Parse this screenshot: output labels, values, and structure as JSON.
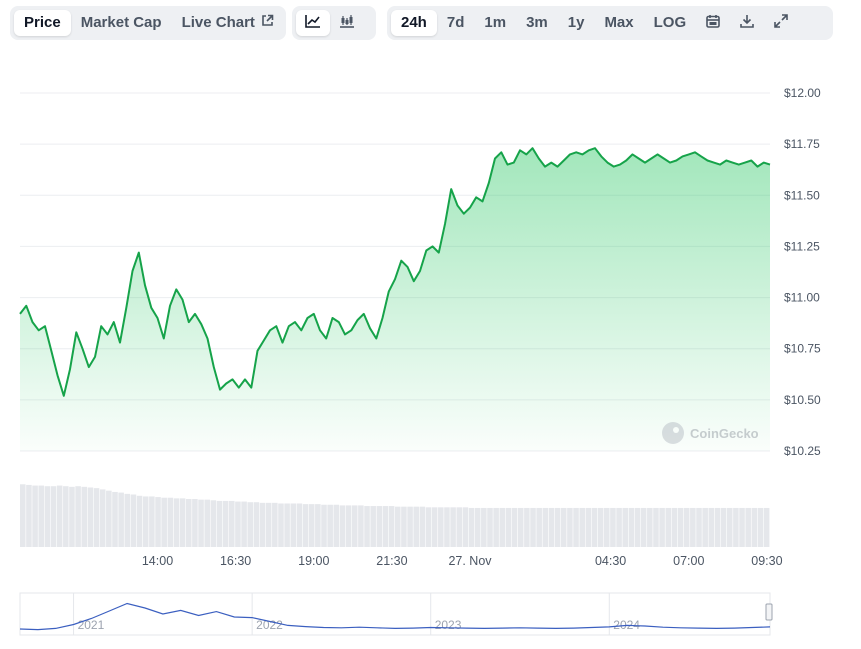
{
  "toolbar": {
    "tabs": [
      "Price",
      "Market Cap",
      "Live Chart"
    ],
    "timeframes": [
      "24h",
      "7d",
      "1m",
      "3m",
      "1y",
      "Max",
      "LOG"
    ],
    "icons": [
      "line-chart-icon",
      "candlestick-icon",
      "calendar-icon",
      "download-icon",
      "expand-icon",
      "external-link-icon"
    ]
  },
  "watermark": "CoinGecko",
  "colors": {
    "line": "#16a34a",
    "area": "#22c55e",
    "volume": "#e5e7eb",
    "navigator": "#3b5fc0"
  },
  "chart_data": {
    "type": "area",
    "currency": "$",
    "ylim": [
      10.25,
      12.0
    ],
    "y_ticks": [
      "$12.00",
      "$11.75",
      "$11.50",
      "$11.25",
      "$11.00",
      "$10.75",
      "$10.50",
      "$10.25"
    ],
    "y_tick_values": [
      12.0,
      11.75,
      11.5,
      11.25,
      11.0,
      10.75,
      10.5,
      10.25
    ],
    "x_ticks": [
      "14:00",
      "16:30",
      "19:00",
      "21:30",
      "27. Nov",
      "04:30",
      "07:00",
      "09:30"
    ],
    "x_tick_hours": [
      14.0,
      16.5,
      19.0,
      21.5,
      24.0,
      28.5,
      31.0,
      33.5
    ],
    "xlim_hours": [
      9.6,
      33.6
    ],
    "price": {
      "hours": [
        9.6,
        9.8,
        10.0,
        10.2,
        10.4,
        10.6,
        10.8,
        11.0,
        11.2,
        11.4,
        11.6,
        11.8,
        12.0,
        12.2,
        12.4,
        12.6,
        12.8,
        13.0,
        13.2,
        13.4,
        13.6,
        13.8,
        14.0,
        14.2,
        14.4,
        14.6,
        14.8,
        15.0,
        15.2,
        15.4,
        15.6,
        15.8,
        16.0,
        16.2,
        16.4,
        16.6,
        16.8,
        17.0,
        17.2,
        17.4,
        17.6,
        17.8,
        18.0,
        18.2,
        18.4,
        18.6,
        18.8,
        19.0,
        19.2,
        19.4,
        19.6,
        19.8,
        20.0,
        20.2,
        20.4,
        20.6,
        20.8,
        21.0,
        21.2,
        21.4,
        21.6,
        21.8,
        22.0,
        22.2,
        22.4,
        22.6,
        22.8,
        23.0,
        23.2,
        23.4,
        23.6,
        23.8,
        24.0,
        24.2,
        24.4,
        24.6,
        24.8,
        25.0,
        25.2,
        25.4,
        25.6,
        25.8,
        26.0,
        26.2,
        26.4,
        26.6,
        26.8,
        27.0,
        27.2,
        27.4,
        27.6,
        27.8,
        28.0,
        28.2,
        28.4,
        28.6,
        28.8,
        29.0,
        29.2,
        29.4,
        29.6,
        29.8,
        30.0,
        30.2,
        30.4,
        30.6,
        30.8,
        31.0,
        31.2,
        31.4,
        31.6,
        31.8,
        32.0,
        32.2,
        32.4,
        32.6,
        32.8,
        33.0,
        33.2,
        33.4,
        33.6
      ],
      "values": [
        10.92,
        10.96,
        10.88,
        10.84,
        10.86,
        10.74,
        10.62,
        10.52,
        10.65,
        10.83,
        10.75,
        10.66,
        10.71,
        10.86,
        10.82,
        10.88,
        10.78,
        10.95,
        11.13,
        11.22,
        11.06,
        10.95,
        10.9,
        10.8,
        10.96,
        11.04,
        10.99,
        10.88,
        10.92,
        10.87,
        10.8,
        10.66,
        10.55,
        10.58,
        10.6,
        10.56,
        10.6,
        10.56,
        10.74,
        10.79,
        10.84,
        10.86,
        10.78,
        10.86,
        10.88,
        10.84,
        10.9,
        10.92,
        10.84,
        10.8,
        10.9,
        10.88,
        10.82,
        10.84,
        10.89,
        10.92,
        10.85,
        10.8,
        10.9,
        11.03,
        11.09,
        11.18,
        11.15,
        11.08,
        11.13,
        11.23,
        11.25,
        11.22,
        11.36,
        11.53,
        11.45,
        11.41,
        11.44,
        11.49,
        11.47,
        11.56,
        11.68,
        11.71,
        11.65,
        11.66,
        11.72,
        11.7,
        11.73,
        11.68,
        11.64,
        11.66,
        11.64,
        11.67,
        11.7,
        11.71,
        11.7,
        11.72,
        11.73,
        11.69,
        11.66,
        11.64,
        11.65,
        11.67,
        11.7,
        11.68,
        11.66,
        11.68,
        11.7,
        11.68,
        11.66,
        11.67,
        11.69,
        11.7,
        11.71,
        11.69,
        11.67,
        11.66,
        11.65,
        11.67,
        11.66,
        11.65,
        11.66,
        11.67,
        11.64,
        11.66,
        11.65
      ]
    },
    "volume_relative": [
      0.98,
      0.97,
      0.96,
      0.96,
      0.95,
      0.95,
      0.96,
      0.95,
      0.94,
      0.95,
      0.94,
      0.93,
      0.92,
      0.9,
      0.88,
      0.86,
      0.85,
      0.83,
      0.82,
      0.8,
      0.79,
      0.79,
      0.78,
      0.77,
      0.77,
      0.76,
      0.76,
      0.75,
      0.75,
      0.74,
      0.74,
      0.73,
      0.72,
      0.72,
      0.72,
      0.71,
      0.71,
      0.7,
      0.7,
      0.69,
      0.69,
      0.69,
      0.68,
      0.68,
      0.68,
      0.68,
      0.67,
      0.67,
      0.67,
      0.66,
      0.66,
      0.66,
      0.65,
      0.65,
      0.65,
      0.65,
      0.64,
      0.64,
      0.64,
      0.64,
      0.64,
      0.63,
      0.63,
      0.63,
      0.63,
      0.63,
      0.62,
      0.62,
      0.62,
      0.62,
      0.62,
      0.62,
      0.62,
      0.61,
      0.61,
      0.61,
      0.61,
      0.61,
      0.61,
      0.61,
      0.61,
      0.61,
      0.61,
      0.61,
      0.61,
      0.61,
      0.61,
      0.61,
      0.61,
      0.61,
      0.61,
      0.61,
      0.61,
      0.61,
      0.61,
      0.61,
      0.61,
      0.61,
      0.61,
      0.61,
      0.61,
      0.61,
      0.61,
      0.61,
      0.61,
      0.61,
      0.61,
      0.61,
      0.61,
      0.61,
      0.61,
      0.61,
      0.61,
      0.61,
      0.61,
      0.61,
      0.61,
      0.61,
      0.61,
      0.61,
      0.61,
      0.61
    ],
    "navigator": {
      "x_labels": [
        "2021",
        "2022",
        "2023",
        "2024"
      ],
      "label_years": [
        2021,
        2022,
        2023,
        2024
      ],
      "range_years": [
        2020.7,
        2024.9
      ],
      "years": [
        2020.7,
        2020.8,
        2020.9,
        2021.0,
        2021.1,
        2021.2,
        2021.3,
        2021.4,
        2021.5,
        2021.6,
        2021.7,
        2021.8,
        2021.9,
        2022.0,
        2022.1,
        2022.2,
        2022.3,
        2022.4,
        2022.5,
        2022.6,
        2022.7,
        2022.8,
        2022.9,
        2023.0,
        2023.1,
        2023.2,
        2023.3,
        2023.4,
        2023.5,
        2023.6,
        2023.7,
        2023.8,
        2023.9,
        2024.0,
        2024.1,
        2024.2,
        2024.3,
        2024.4,
        2024.5,
        2024.6,
        2024.7,
        2024.8,
        2024.9
      ],
      "relative": [
        0.1,
        0.08,
        0.12,
        0.25,
        0.45,
        0.7,
        0.95,
        0.8,
        0.6,
        0.72,
        0.55,
        0.68,
        0.5,
        0.48,
        0.35,
        0.22,
        0.18,
        0.15,
        0.14,
        0.16,
        0.14,
        0.12,
        0.13,
        0.15,
        0.14,
        0.13,
        0.12,
        0.13,
        0.14,
        0.13,
        0.12,
        0.13,
        0.15,
        0.17,
        0.22,
        0.2,
        0.16,
        0.14,
        0.13,
        0.12,
        0.13,
        0.15,
        0.17
      ]
    }
  }
}
